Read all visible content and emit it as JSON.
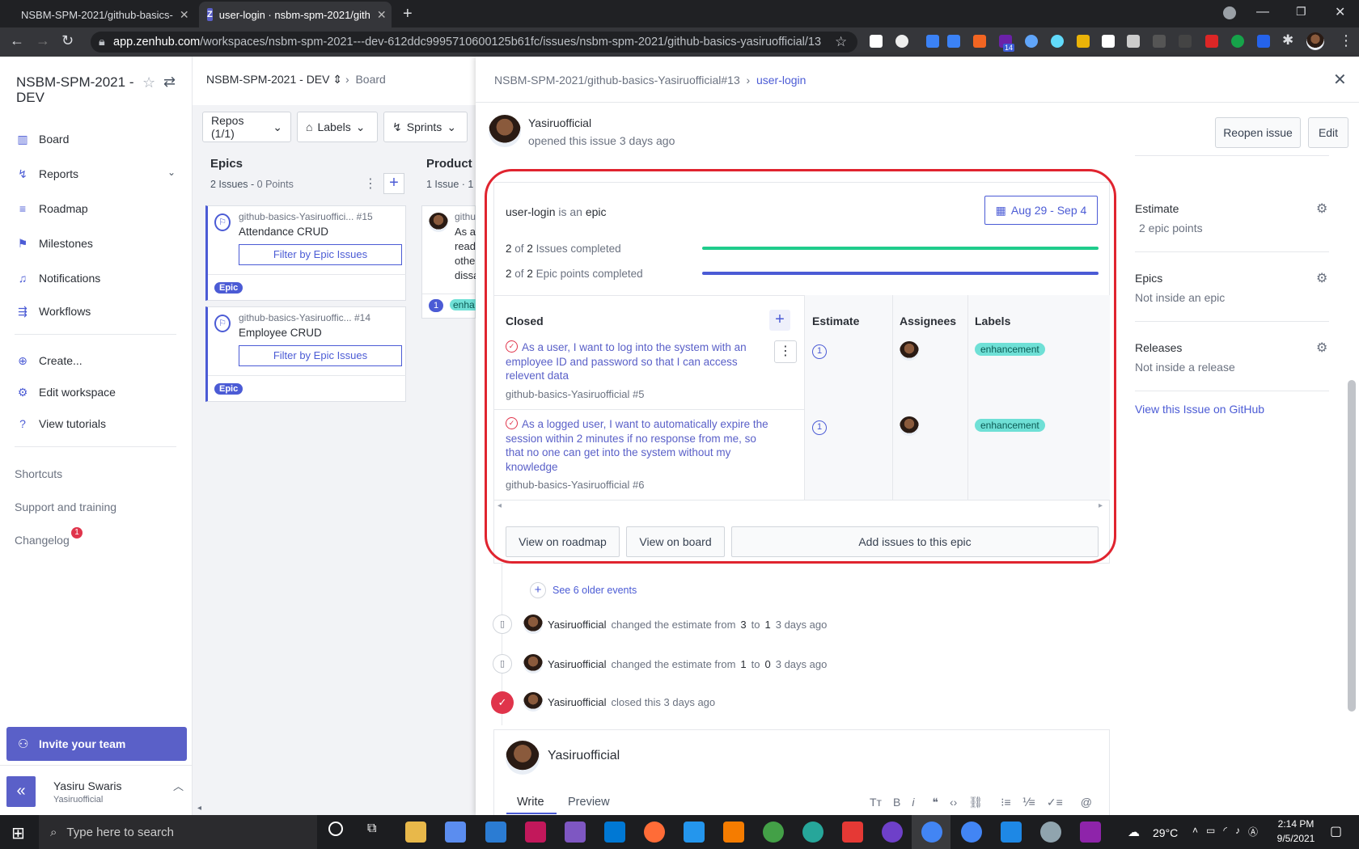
{
  "browser": {
    "tabs": [
      {
        "title": "NSBM-SPM-2021/github-basics-"
      },
      {
        "title": "user-login · nsbm-spm-2021/gith"
      }
    ],
    "url_host": "app.zenhub.com",
    "url_path": "/workspaces/nsbm-spm-2021---dev-612ddc9995710600125b61fc/issues/nsbm-spm-2021/github-basics-yasiruofficial/13",
    "ext_badge": "14"
  },
  "sidebar": {
    "workspace": "NSBM-SPM-2021 - DEV",
    "nav": [
      "Board",
      "Reports",
      "Roadmap",
      "Milestones",
      "Notifications",
      "Workflows"
    ],
    "actions": [
      "Create...",
      "Edit workspace",
      "View tutorials"
    ],
    "links": [
      "Shortcuts",
      "Support and training",
      "Changelog"
    ],
    "changelog_count": "1",
    "invite": "Invite your team",
    "user_name": "Yasiru Swaris",
    "user_handle": "Yasiruofficial"
  },
  "board": {
    "breadcrumb": "NSBM-SPM-2021 - DEV",
    "breadcrumb_page": "Board",
    "filters": [
      "Repos (1/1)",
      "Labels",
      "Sprints"
    ],
    "epics_col": {
      "title": "Epics",
      "issues": "2 Issues",
      "points": "0 Points"
    },
    "product_col": {
      "title": "Product B",
      "issues": "1 Issue",
      "points": "· 1"
    },
    "epic_cards": [
      {
        "repo": "github-basics-Yasiruoffici...",
        "num": "#15",
        "title": "Attendance CRUD",
        "filter": "Filter by Epic Issues",
        "pill": "Epic"
      },
      {
        "repo": "github-basics-Yasiruoffic...",
        "num": "#14",
        "title": "Employee CRUD",
        "filter": "Filter by Epic Issues",
        "pill": "Epic"
      }
    ],
    "product_card": {
      "repo": "githu",
      "lines": [
        "As a",
        "read",
        "othe",
        "dissa"
      ],
      "est": "1",
      "label": "enha"
    }
  },
  "panel": {
    "crumb_repo": "NSBM-SPM-2021/github-basics-Yasiruofficial#13",
    "crumb_issue": "user-login",
    "author": "Yasiruofficial",
    "opened": "opened this issue 3 days ago",
    "reopen": "Reopen issue",
    "edit": "Edit",
    "epic": {
      "name": "user-login",
      "is_an": "is an",
      "epic_word": "epic",
      "dates": "Aug 29 - Sep 4",
      "issues_done": "2",
      "issues_total": "2",
      "issues_label": "Issues completed",
      "points_done": "2",
      "points_total": "2",
      "points_label": "Epic points completed",
      "of": "of",
      "columns": [
        "Closed",
        "Estimate",
        "Assignees",
        "Labels"
      ],
      "issues": [
        {
          "title": "As a user, I want to log into the system with an employee ID and password so that I can access relevent data",
          "repo": "github-basics-Yasiruofficial #5",
          "estimate": "1",
          "label": "enhancement"
        },
        {
          "title": "As a logged user, I want to automatically expire the session within 2 minutes if no response from me, so that no one can get into the system without my knowledge",
          "repo": "github-basics-Yasiruofficial #6",
          "estimate": "1",
          "label": "enhancement"
        }
      ],
      "buttons": [
        "View on roadmap",
        "View on board",
        "Add issues to this epic"
      ]
    },
    "older": "See 6 older events",
    "events": [
      {
        "user": "Yasiruofficial",
        "pre": "changed the estimate from",
        "from": "3",
        "to_word": "to",
        "to": "1",
        "ago": "3 days ago"
      },
      {
        "user": "Yasiruofficial",
        "pre": "changed the estimate from",
        "from": "1",
        "to_word": "to",
        "to": "0",
        "ago": "3 days ago"
      }
    ],
    "closed_event": {
      "user": "Yasiruofficial",
      "text": "closed this 3 days ago"
    },
    "comment": {
      "user": "Yasiruofficial",
      "tabs": [
        "Write",
        "Preview"
      ]
    },
    "right": {
      "estimate_label": "Estimate",
      "estimate_val": "2 epic points",
      "epics_label": "Epics",
      "epics_val": "Not inside an epic",
      "releases_label": "Releases",
      "releases_val": "Not inside a release",
      "github_link": "View this Issue on GitHub"
    }
  },
  "taskbar": {
    "search": "Type here to search",
    "weather": "29°C",
    "time": "2:14 PM",
    "date": "9/5/2021"
  },
  "colors": {
    "accent": "#4b5bd5",
    "highlight": "#e0242f",
    "progress_issues": "#1fcc8c"
  }
}
